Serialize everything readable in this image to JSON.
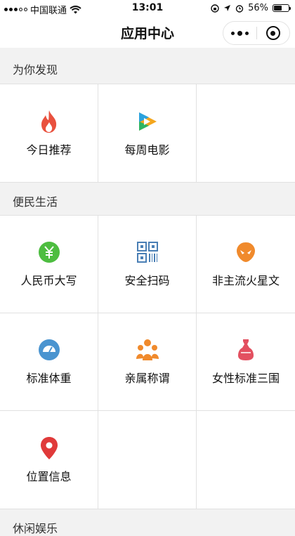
{
  "status_bar": {
    "carrier": "中国联通",
    "time": "13:01",
    "battery": "56%",
    "battery_level": 0.56
  },
  "nav": {
    "title": "应用中心"
  },
  "sections": [
    {
      "title": "为你发现",
      "items": [
        {
          "label": "今日推荐",
          "icon": "flame-icon"
        },
        {
          "label": "每周电影",
          "icon": "video-play-icon"
        }
      ]
    },
    {
      "title": "便民生活",
      "items": [
        {
          "label": "人民币大写",
          "icon": "yuan-icon"
        },
        {
          "label": "安全扫码",
          "icon": "qr-barcode-icon"
        },
        {
          "label": "非主流火星文",
          "icon": "alien-icon"
        },
        {
          "label": "标准体重",
          "icon": "scale-icon"
        },
        {
          "label": "亲属称谓",
          "icon": "family-icon"
        },
        {
          "label": "女性标准三围",
          "icon": "dress-icon"
        },
        {
          "label": "位置信息",
          "icon": "location-pin-icon"
        }
      ]
    },
    {
      "title": "休闲娱乐",
      "items": []
    }
  ],
  "colors": {
    "flame": "#e9513e",
    "yuan": "#4dbd40",
    "scan": "#4a7fb5",
    "alien": "#f08a2c",
    "scale": "#4a94d0",
    "family": "#f08a2c",
    "dress": "#e35060",
    "pin": "#e03a3a"
  }
}
